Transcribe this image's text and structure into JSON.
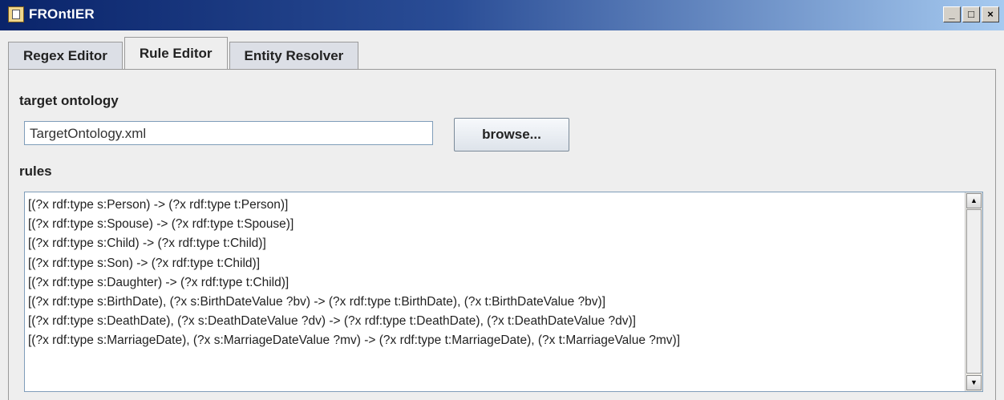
{
  "window": {
    "title": "FROntIER",
    "controls": {
      "minimize": "_",
      "maximize": "□",
      "close": "×"
    }
  },
  "tabs": [
    {
      "label": "Regex Editor",
      "active": false
    },
    {
      "label": "Rule Editor",
      "active": true
    },
    {
      "label": "Entity Resolver",
      "active": false
    }
  ],
  "rule_editor": {
    "target_ontology_label": "target ontology",
    "target_ontology_value": "TargetOntology.xml",
    "browse_label": "browse...",
    "rules_label": "rules",
    "rules": [
      "[(?x rdf:type s:Person) -> (?x rdf:type t:Person)]",
      "[(?x rdf:type s:Spouse) -> (?x rdf:type t:Spouse)]",
      "[(?x rdf:type s:Child) -> (?x rdf:type t:Child)]",
      "[(?x rdf:type s:Son) -> (?x rdf:type t:Child)]",
      "[(?x rdf:type s:Daughter) -> (?x rdf:type t:Child)]",
      "[(?x rdf:type s:BirthDate), (?x s:BirthDateValue ?bv) -> (?x rdf:type t:BirthDate), (?x t:BirthDateValue ?bv)]",
      "[(?x rdf:type s:DeathDate), (?x s:DeathDateValue ?dv) -> (?x rdf:type t:DeathDate), (?x t:DeathDateValue ?dv)]",
      "[(?x rdf:type s:MarriageDate), (?x s:MarriageDateValue ?mv) -> (?x rdf:type t:MarriageDate), (?x t:MarriageValue ?mv)]"
    ]
  },
  "icons": {
    "app": "frontier-app-icon",
    "scroll_up": "▲",
    "scroll_down": "▼"
  },
  "colors": {
    "titlebar_start": "#0a246a",
    "titlebar_end": "#a6caf0",
    "panel_bg": "#eeeeee"
  }
}
